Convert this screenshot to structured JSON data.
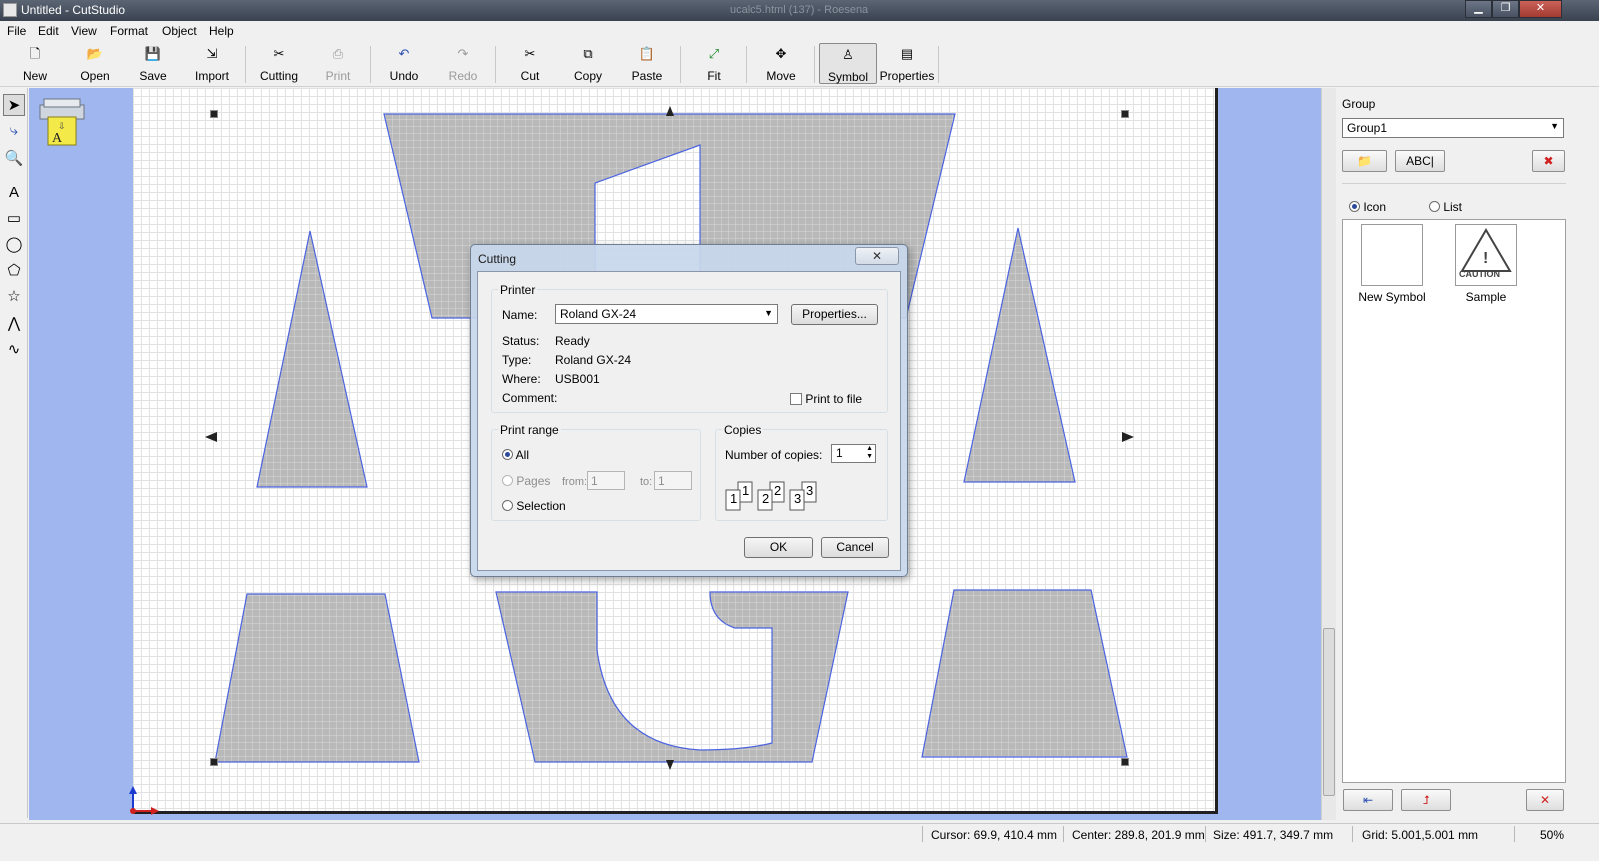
{
  "window": {
    "title": "Untitled - CutStudio",
    "ghost_title": "ucalc5.html (137) - Roesena",
    "controls": {
      "minimize": "▁",
      "maximize": "❐",
      "close": "✕"
    }
  },
  "menu": [
    "File",
    "Edit",
    "View",
    "Format",
    "Object",
    "Help"
  ],
  "toolbar": [
    {
      "label": "New",
      "icon": "new-document-icon",
      "glyph": "🗋"
    },
    {
      "label": "Open",
      "icon": "open-folder-icon",
      "glyph": "📂"
    },
    {
      "label": "Save",
      "icon": "save-disk-icon",
      "glyph": "💾"
    },
    {
      "label": "Import",
      "icon": "import-icon",
      "glyph": "⇲"
    },
    {
      "label": "Cutting",
      "icon": "cutting-icon",
      "glyph": "✂"
    },
    {
      "label": "Print",
      "icon": "printer-icon",
      "glyph": "⎙",
      "disabled": true
    },
    {
      "label": "Undo",
      "icon": "undo-icon",
      "glyph": "↶"
    },
    {
      "label": "Redo",
      "icon": "redo-icon",
      "glyph": "↷",
      "disabled": true
    },
    {
      "label": "Cut",
      "icon": "scissors-icon",
      "glyph": "✂"
    },
    {
      "label": "Copy",
      "icon": "copy-icon",
      "glyph": "⧉"
    },
    {
      "label": "Paste",
      "icon": "paste-icon",
      "glyph": "📋"
    },
    {
      "label": "Fit",
      "icon": "fit-icon",
      "glyph": "⤢"
    },
    {
      "label": "Move",
      "icon": "move-icon",
      "glyph": "✥"
    },
    {
      "label": "Symbol",
      "icon": "symbol-icon",
      "glyph": "♙",
      "active": true
    },
    {
      "label": "Properties",
      "icon": "properties-icon",
      "glyph": "▤"
    }
  ],
  "left_tools": [
    {
      "name": "select-arrow-icon",
      "glyph": "➤",
      "selected": true
    },
    {
      "name": "edit-points-icon",
      "glyph": "⤷"
    },
    {
      "name": "zoom-icon",
      "glyph": "🔍"
    },
    {
      "name": "text-tool-icon",
      "glyph": "A"
    },
    {
      "name": "rectangle-tool-icon",
      "glyph": "▭"
    },
    {
      "name": "ellipse-tool-icon",
      "glyph": "◯"
    },
    {
      "name": "polygon-tool-icon",
      "glyph": "⬠"
    },
    {
      "name": "star-tool-icon",
      "glyph": "☆"
    },
    {
      "name": "polyline-tool-icon",
      "glyph": "⋀"
    },
    {
      "name": "curve-tool-icon",
      "glyph": "∿"
    }
  ],
  "right_panel": {
    "group_label": "Group",
    "group_value": "Group1",
    "abc_button": "ABC|",
    "view_icon_label": "Icon",
    "view_list_label": "List",
    "symbols": [
      {
        "label": "New Symbol"
      },
      {
        "label": "Sample",
        "badge": "CAUTION"
      }
    ]
  },
  "status": {
    "cursor": "Cursor: 69.9, 410.4 mm",
    "center": "Center: 289.8, 201.9 mm",
    "size": "Size: 491.7, 349.7 mm",
    "grid": "Grid: 5.001,5.001 mm",
    "zoom": "50%"
  },
  "dialog": {
    "title": "Cutting",
    "close": "✕",
    "printer_group": "Printer",
    "name_label": "Name:",
    "name_value": "Roland GX-24",
    "properties_button": "Properties...",
    "status_label": "Status:",
    "status_value": "Ready",
    "type_label": "Type:",
    "type_value": "Roland GX-24",
    "where_label": "Where:",
    "where_value": "USB001",
    "comment_label": "Comment:",
    "print_to_file": "Print to file",
    "range_group": "Print range",
    "range_all": "All",
    "range_pages": "Pages",
    "from_label": "from:",
    "from_value": "1",
    "to_label": "to:",
    "to_value": "1",
    "range_selection": "Selection",
    "copies_group": "Copies",
    "copies_label": "Number of copies:",
    "copies_value": "1",
    "collate_icons": [
      "1",
      "1",
      "2",
      "2",
      "3",
      "3"
    ],
    "ok": "OK",
    "cancel": "Cancel"
  }
}
